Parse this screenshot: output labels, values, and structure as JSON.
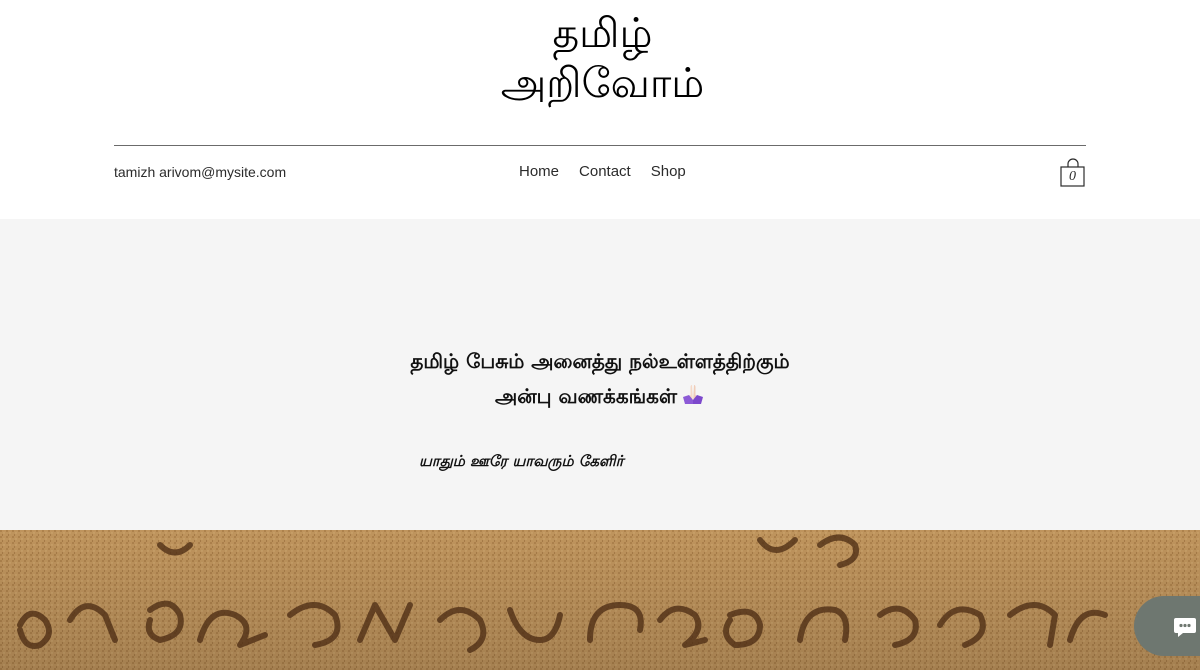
{
  "header": {
    "title_line1": "தமிழ்",
    "title_line2": "அறிவோம்",
    "email": "tamizh arivom@mysite.com",
    "nav": [
      {
        "label": "Home"
      },
      {
        "label": "Contact"
      },
      {
        "label": "Shop"
      }
    ],
    "cart": {
      "count": "0",
      "icon": "shopping-bag-icon"
    }
  },
  "hero": {
    "greeting_line1": "தமிழ் பேசும் அனைத்து நல்உள்ளத்திற்கும்",
    "greeting_line2": "அன்பு வணக்கங்கள்",
    "emoji": "folded-hands",
    "quote": "யாதும் ஊரே யாவரும் கேளிர்"
  },
  "banner": {
    "image": "stone-inscription-tamili-script"
  },
  "chat": {
    "icon": "chat-bubble-icon"
  },
  "colors": {
    "header_bg": "#ffffff",
    "strip_bg": "#f5f5f5",
    "banner_stone": "#c79a60",
    "chat_button": "#6e7770"
  }
}
